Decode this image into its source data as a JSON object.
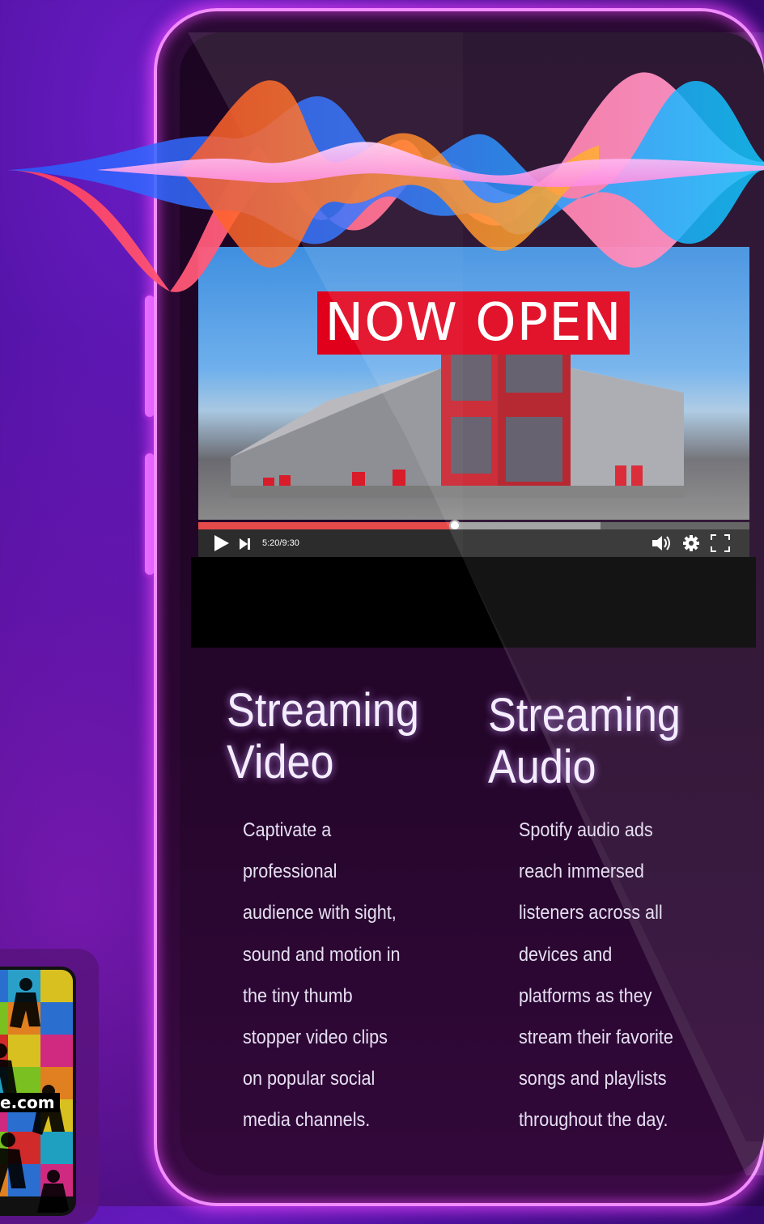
{
  "video": {
    "overlay_text": "NOW OPEN",
    "time": "5:20/9:30",
    "progress_fraction": 0.465,
    "buffered_fraction": 0.73
  },
  "columns": [
    {
      "heading": [
        "Streaming",
        "Video"
      ],
      "lines": [
        "Captivate a",
        "professional",
        "audience with sight,",
        "sound and motion in",
        "the tiny thumb",
        "stopper video clips",
        "on popular social",
        "media channels."
      ]
    },
    {
      "heading": [
        "Streaming",
        "Audio"
      ],
      "lines": [
        "Spotify audio ads",
        "reach immersed",
        "listeners across all",
        "devices and",
        "platforms as they",
        "stream their favorite",
        "songs and playlists",
        "throughout the day."
      ]
    }
  ],
  "side_phone": {
    "url_fragment": "e.com"
  },
  "colors": {
    "accent_glow": "#f28cff",
    "banner_red": "#e0001b",
    "progress_red": "#e44a4a"
  }
}
